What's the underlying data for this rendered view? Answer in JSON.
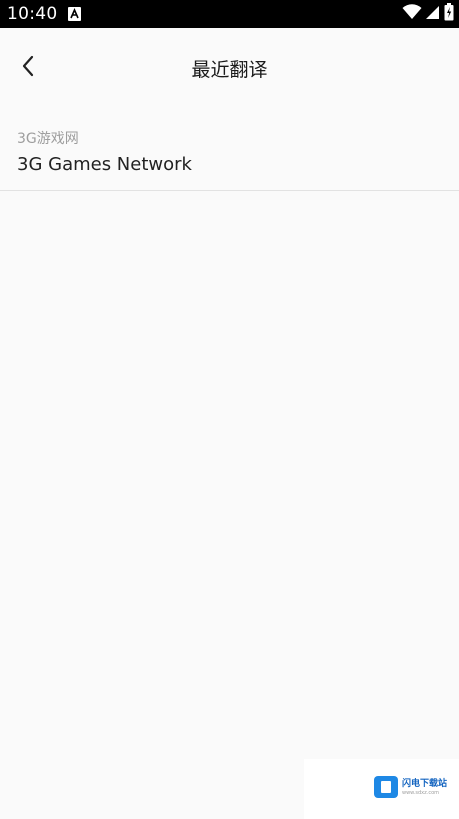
{
  "status_bar": {
    "time": "10:40",
    "icons": [
      "notification-a-icon",
      "wifi-icon",
      "signal-icon",
      "battery-icon"
    ]
  },
  "header": {
    "title": "最近翻译",
    "back_icon": "chevron-left-icon"
  },
  "history": {
    "items": [
      {
        "source": "3G游戏网",
        "translation": "3G Games Network"
      }
    ]
  },
  "watermark": {
    "text": "闪电下载站",
    "subtext": "www.sdxz.com",
    "color": "#1e88e5"
  },
  "colors": {
    "background": "#fafafa",
    "status_bar": "#000000",
    "divider": "#e2e2e2",
    "source_text": "#9e9e9e",
    "target_text": "#222222"
  }
}
